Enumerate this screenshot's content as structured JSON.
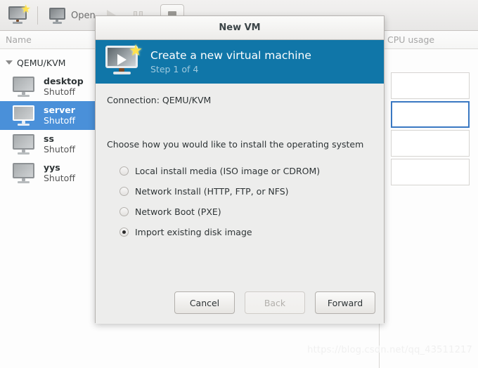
{
  "main_window": {
    "toolbar": {
      "new_vm_icon": "new-vm-monitor-star-icon",
      "open_label": "Open",
      "open_icon": "monitor-icon",
      "run_icon": "play-icon",
      "pause_icon": "pause-icon",
      "stop_icon": "stop-icon"
    },
    "columns": [
      {
        "label": "Name"
      },
      {
        "label": "CPU usage"
      }
    ],
    "group": {
      "label": "QEMU/KVM",
      "expander_icon": "chevron-down-icon",
      "expanded": true
    },
    "vms": [
      {
        "name": "desktop",
        "state": "Shutoff",
        "selected": false,
        "icon": "monitor-icon"
      },
      {
        "name": "server",
        "state": "Shutoff",
        "selected": true,
        "icon": "monitor-icon"
      },
      {
        "name": "ss",
        "state": "Shutoff",
        "selected": false,
        "icon": "monitor-icon"
      },
      {
        "name": "yys",
        "state": "Shutoff",
        "selected": false,
        "icon": "monitor-icon"
      }
    ],
    "watermark": "https://blog.csdn.net/qq_43511217"
  },
  "dialog": {
    "title": "New VM",
    "banner": {
      "icon": "new-vm-monitor-star-icon",
      "heading": "Create a new virtual machine",
      "step": "Step 1 of 4"
    },
    "connection": "Connection:  QEMU/KVM",
    "choose_label": "Choose how you would like to install the operating system",
    "install_options": [
      {
        "label": "Local install media (ISO image or CDROM)",
        "checked": false
      },
      {
        "label": "Network Install (HTTP, FTP, or NFS)",
        "checked": false
      },
      {
        "label": "Network Boot (PXE)",
        "checked": false
      },
      {
        "label": "Import existing disk image",
        "checked": true
      }
    ],
    "buttons": [
      {
        "label": "Cancel",
        "disabled": false,
        "name": "cancel-button"
      },
      {
        "label": "Back",
        "disabled": true,
        "name": "back-button"
      },
      {
        "label": "Forward",
        "disabled": false,
        "name": "forward-button"
      }
    ]
  },
  "colors": {
    "banner_blue": "#1076a8",
    "selection_blue": "#4a90d9",
    "dialog_bg": "#ededec",
    "toolbar_bg": "#eeedec"
  }
}
